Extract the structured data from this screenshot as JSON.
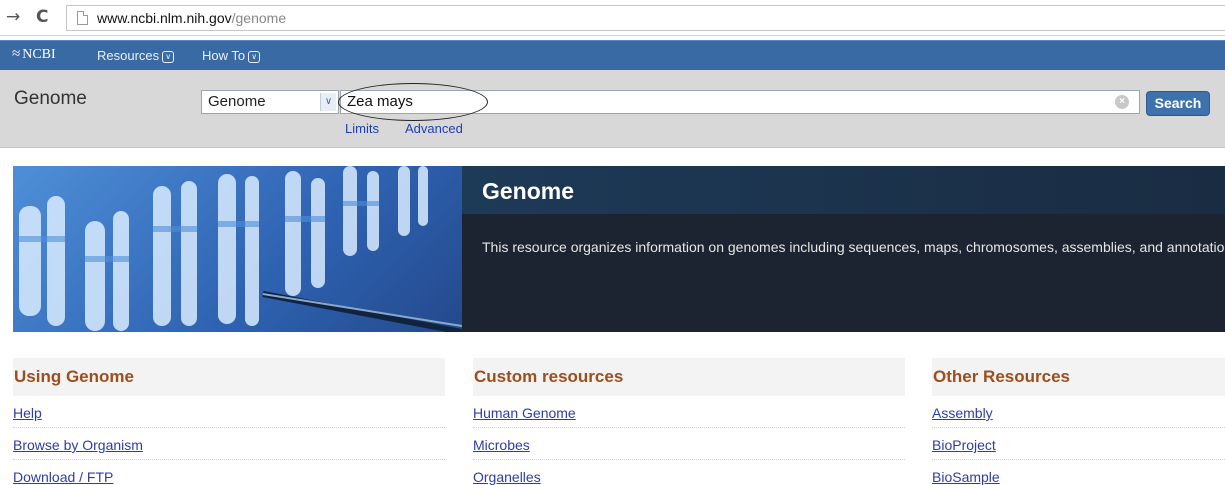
{
  "browser": {
    "url_host": "www.ncbi.nlm.nih.gov",
    "url_path": "/genome",
    "back_icon": "→",
    "reload_icon": "C"
  },
  "ncbi_bar": {
    "logo": "NCBI",
    "menus": [
      "Resources",
      "How To"
    ]
  },
  "search": {
    "db_title": "Genome",
    "db_selected": "Genome",
    "query": "Zea mays",
    "button_label": "Search",
    "links": [
      "Limits",
      "Advanced"
    ]
  },
  "hero": {
    "title": "Genome",
    "description": "This resource organizes information on genomes including sequences, maps, chromosomes, assemblies, and annotations."
  },
  "columns": [
    {
      "heading": "Using Genome",
      "items": [
        "Help",
        "Browse by Organism",
        "Download / FTP"
      ]
    },
    {
      "heading": "Custom resources",
      "items": [
        "Human Genome",
        "Microbes",
        "Organelles"
      ]
    },
    {
      "heading": "Other Resources",
      "items": [
        "Assembly",
        "BioProject",
        "BioSample"
      ]
    }
  ],
  "colors": {
    "ncbi_blue": "#3a6aa3",
    "heading_orange": "#9c4f1d",
    "link_blue": "#2b3ea8",
    "hero_dark": "#1c2431"
  }
}
